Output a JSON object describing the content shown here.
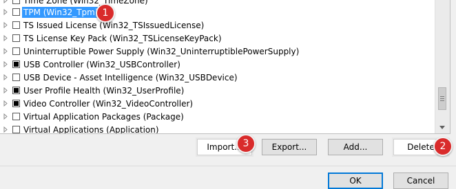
{
  "tree": {
    "partial_top_item": "Time Zone (Win32_TimeZone)",
    "items": [
      {
        "label": "TPM (Win32_Tpm)",
        "state": "unchecked",
        "selected": true
      },
      {
        "label": "TS Issued License (Win32_TSIssuedLicense)",
        "state": "unchecked",
        "selected": false
      },
      {
        "label": "TS License Key Pack (Win32_TSLicenseKeyPack)",
        "state": "unchecked",
        "selected": false
      },
      {
        "label": "Uninterruptible Power Supply (Win32_UninterruptiblePowerSupply)",
        "state": "unchecked",
        "selected": false
      },
      {
        "label": "USB Controller (Win32_USBController)",
        "state": "indeterminate",
        "selected": false
      },
      {
        "label": "USB Device - Asset Intelligence (Win32_USBDevice)",
        "state": "unchecked",
        "selected": false
      },
      {
        "label": "User Profile Health (Win32_UserProfile)",
        "state": "indeterminate",
        "selected": false
      },
      {
        "label": "Video Controller (Win32_VideoController)",
        "state": "indeterminate",
        "selected": false
      },
      {
        "label": "Virtual Application Packages (Package)",
        "state": "unchecked",
        "selected": false
      },
      {
        "label": "Virtual Applications (Application)",
        "state": "unchecked",
        "selected": false
      }
    ]
  },
  "buttons": {
    "import": "Import...",
    "export": "Export...",
    "add": "Add...",
    "delete": "Delete",
    "ok": "OK",
    "cancel": "Cancel"
  },
  "annotations": {
    "badge1": "1",
    "badge2": "2",
    "badge3": "3"
  },
  "colors": {
    "selection": "#3399ff",
    "badge": "#d92b2b",
    "focus": "#0078d7"
  }
}
